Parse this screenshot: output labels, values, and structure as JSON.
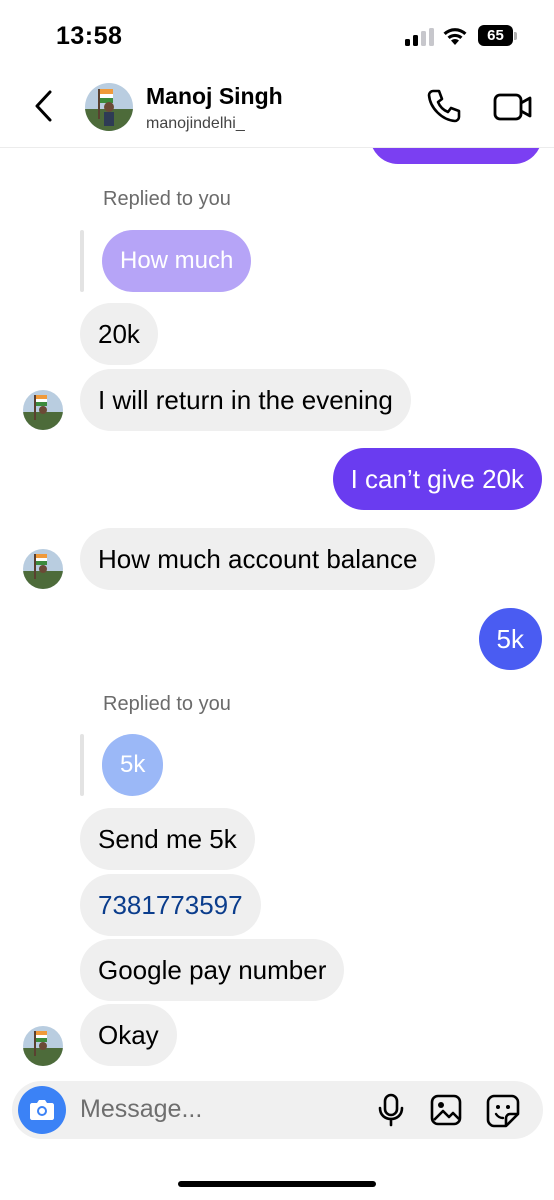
{
  "status_bar": {
    "time": "13:58",
    "battery": "65",
    "cellular_bars": 2,
    "wifi": true
  },
  "header": {
    "name": "Manoj Singh",
    "handle": "manojindelhi_"
  },
  "colors": {
    "outgoing_purple": "#6a3cf0",
    "outgoing_blue": "#4a5cf2",
    "quote_purple": "#b6a4f7",
    "quote_blue": "#9bb8f7",
    "incoming_bg": "#efefef",
    "link": "#0b3d8c"
  },
  "messages": {
    "replied_label_1": "Replied to you",
    "quote_1": "How much",
    "m1": "20k",
    "m2": "I will return in the evening",
    "m3": "I can’t give 20k",
    "m4": "How much account balance",
    "m5": "5k",
    "replied_label_2": "Replied to you",
    "quote_2": "5k",
    "m6": "Send me 5k",
    "m7": "7381773597",
    "m8": "Google pay number",
    "m9": "Okay"
  },
  "composer": {
    "placeholder": "Message..."
  },
  "icons": [
    "back-icon",
    "phone-icon",
    "video-icon",
    "camera-icon",
    "microphone-icon",
    "gallery-icon",
    "sticker-icon"
  ]
}
